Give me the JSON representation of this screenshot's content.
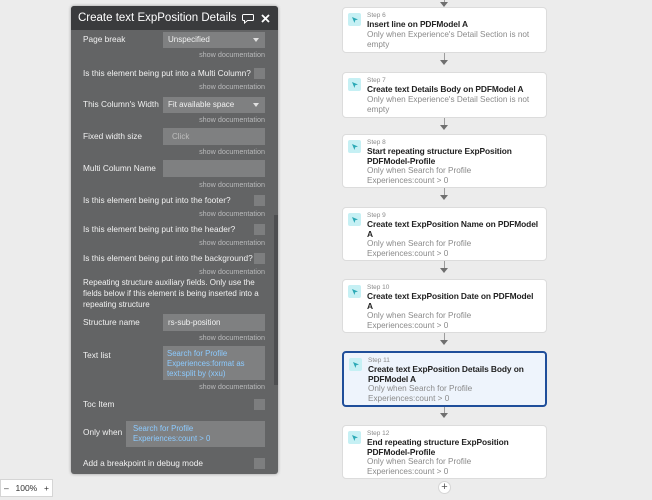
{
  "panel": {
    "title": "Create text ExpPosition Details Body",
    "show_doc": "show documentation",
    "fields": {
      "page_break": {
        "label": "Page break",
        "value": "Unspecified"
      },
      "multi_column_q": {
        "label": "Is this element being put into a Multi Column?"
      },
      "column_width": {
        "label": "This Column's Width",
        "value": "Fit available space"
      },
      "fixed_width": {
        "label": "Fixed width size",
        "placeholder": "Click"
      },
      "multi_column_name": {
        "label": "Multi Column Name"
      },
      "footer_q": {
        "label": "Is this element being put into the footer?"
      },
      "header_q": {
        "label": "Is this element being put into the header?"
      },
      "background_q": {
        "label": "Is this element being put into the background?"
      },
      "repeating_note": "Repeating structure auxiliary fields. Only use the fields below if this element is being inserted into a repeating structure",
      "structure_name": {
        "label": "Structure name",
        "value": "rs-sub-position"
      },
      "text_list": {
        "label": "Text list",
        "value": "Search for Profile Experiences:format as text:split by (xxu)"
      },
      "toc_item": {
        "label": "Toc Item"
      },
      "only_when": {
        "label": "Only when",
        "value": "Search for Profile Experiences:count > 0"
      },
      "breakpoint": {
        "label": "Add a breakpoint in debug mode"
      }
    }
  },
  "workflow": {
    "steps": [
      {
        "step": "Step 6",
        "title": "Insert line on PDFModel A",
        "condition": "Only when Experience's Detail Section is not empty"
      },
      {
        "step": "Step 7",
        "title": "Create text Details Body on PDFModel A",
        "condition": "Only when Experience's Detail Section is not empty"
      },
      {
        "step": "Step 8",
        "title": "Start repeating structure ExpPosition PDFModel-Profile",
        "condition": "Only when Search for Profile Experiences:count > 0"
      },
      {
        "step": "Step 9",
        "title": "Create text ExpPosition Name on PDFModel A",
        "condition": "Only when Search for Profile Experiences:count > 0"
      },
      {
        "step": "Step 10",
        "title": "Create text ExpPosition Date on PDFModel A",
        "condition": "Only when Search for Profile Experiences:count > 0"
      },
      {
        "step": "Step 11",
        "title": "Create text ExpPosition Details Body on PDFModel A",
        "condition": "Only when Search for Profile Experiences:count > 0"
      },
      {
        "step": "Step 12",
        "title": "End repeating structure ExpPosition PDFModel-Profile",
        "condition": "Only when Search for Profile Experiences:count > 0"
      }
    ],
    "add_label": "+"
  },
  "zoom": {
    "minus": "–",
    "value": "100%",
    "plus": "+"
  },
  "icons": {
    "comment": "comment-icon",
    "close": "close-icon",
    "step": "cursor-icon"
  },
  "colors": {
    "panel_bg": "#636465",
    "panel_header": "#3a3b3d",
    "link": "#8ccaff",
    "selected_border": "#1f4e9a",
    "step_icon_bg": "#c6f0f4"
  }
}
